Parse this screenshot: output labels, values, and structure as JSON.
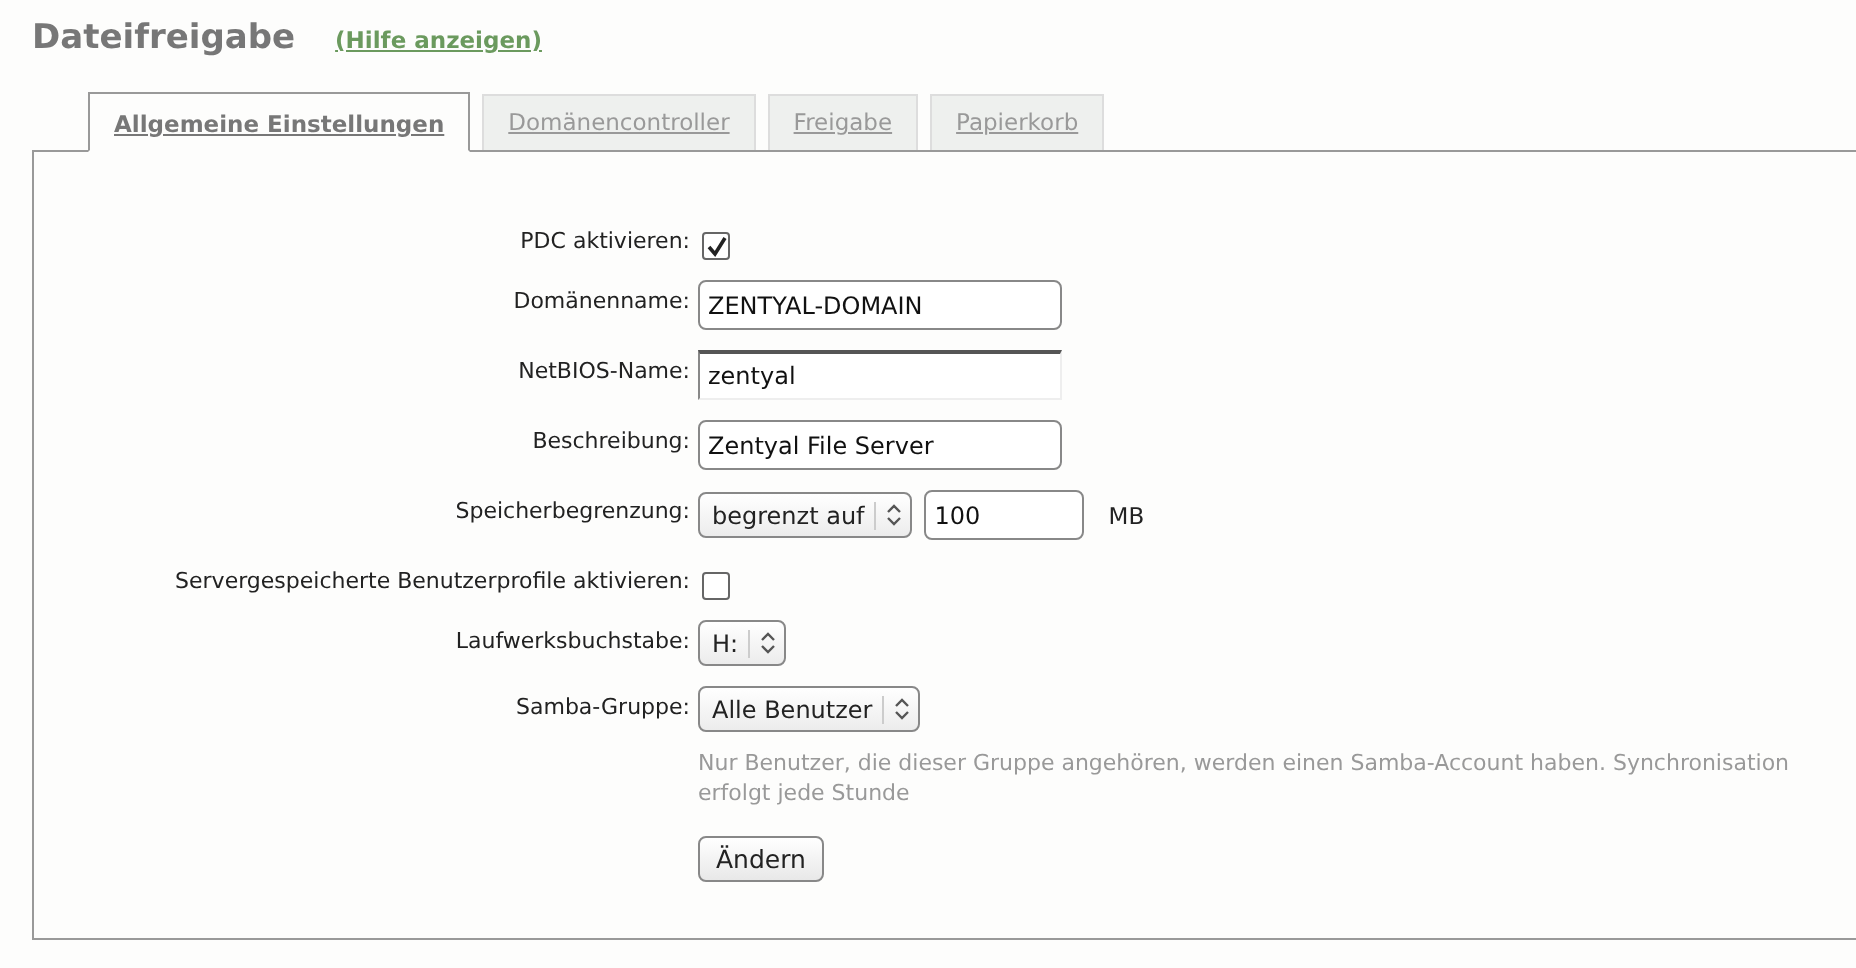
{
  "page": {
    "title": "Dateifreigabe",
    "help_link": "(Hilfe anzeigen)"
  },
  "tabs": [
    {
      "label": "Allgemeine Einstellungen",
      "selected": true
    },
    {
      "label": "Domänencontroller",
      "selected": false
    },
    {
      "label": "Freigabe",
      "selected": false
    },
    {
      "label": "Papierkorb",
      "selected": false
    }
  ],
  "form": {
    "fields": [
      {
        "kind": "checkbox",
        "label": "PDC aktivieren:",
        "checked": true
      },
      {
        "kind": "text",
        "label": "Domänenname:",
        "value": "ZENTYAL-DOMAIN",
        "focused": false
      },
      {
        "kind": "text",
        "label": "NetBIOS-Name:",
        "value": "zentyal",
        "focused": true
      },
      {
        "kind": "text",
        "label": "Beschreibung:",
        "value": "Zentyal File Server",
        "focused": false
      },
      {
        "kind": "select_text",
        "label": "Speicherbegrenzung:",
        "option": "begrenzt auf",
        "value": "100",
        "unit": "MB"
      },
      {
        "kind": "checkbox",
        "label": "Servergespeicherte Benutzerprofile aktivieren:",
        "checked": false
      },
      {
        "kind": "select",
        "label": "Laufwerksbuchstabe:",
        "option": "H:"
      },
      {
        "kind": "select",
        "label": "Samba-Gruppe:",
        "option": "Alle Benutzer",
        "help": "Nur Benutzer, die dieser Gruppe angehören, werden einen Samba-Account haben. Synchronisation erfolgt jede Stunde"
      }
    ],
    "submit": "Ändern"
  }
}
